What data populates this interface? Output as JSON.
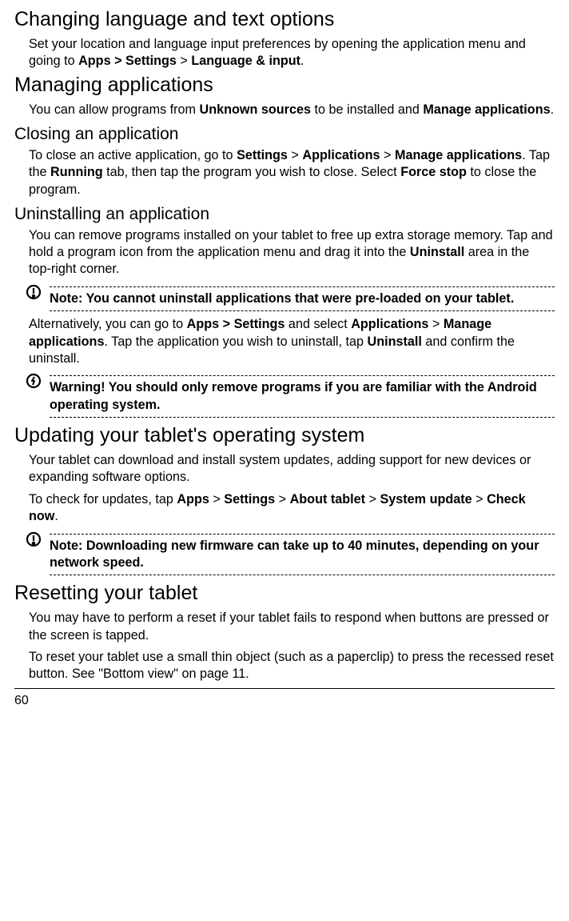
{
  "page_number": "60",
  "s1": {
    "title": "Changing language and text options",
    "p1_a": "Set your location and language input preferences by opening the application menu and going to ",
    "p1_b": "Apps > Settings",
    "p1_c": " > ",
    "p1_d": "Language & input",
    "p1_e": "."
  },
  "s2": {
    "title": "Managing applications",
    "p1_a": "You can allow programs from ",
    "p1_b": "Unknown sources",
    "p1_c": " to be installed and ",
    "p1_d": "Manage applications",
    "p1_e": "."
  },
  "s3": {
    "title": "Closing an application",
    "p1_a": "To close an active application, go to ",
    "p1_b": "Settings",
    "p1_c": " > ",
    "p1_d": "Applications",
    "p1_e": " > ",
    "p1_f": "Manage applications",
    "p1_g": ". Tap the ",
    "p1_h": "Running",
    "p1_i": " tab, then tap the program you wish to close. Select ",
    "p1_j": "Force stop",
    "p1_k": " to close the program."
  },
  "s4": {
    "title": "Uninstalling an application",
    "p1_a": "You can remove programs installed on your tablet to free up extra storage memory. Tap and hold a program icon from the application menu and drag it into the ",
    "p1_b": "Uninstall",
    "p1_c": " area in the top-right corner.",
    "note1": "Note: You cannot uninstall applications that were pre-loaded on your tablet.",
    "p2_a": "Alternatively, you can go to ",
    "p2_b": "Apps > Settings",
    "p2_c": " and select ",
    "p2_d": "Applications",
    "p2_e": " > ",
    "p2_f": "Manage applications",
    "p2_g": ". Tap the application you wish to uninstall, tap ",
    "p2_h": "Uninstall",
    "p2_i": " and confirm the uninstall.",
    "warn1": "Warning! You should only remove programs if you are familiar with the Android operating system."
  },
  "s5": {
    "title": "Updating your tablet's operating system",
    "p1": "Your tablet can download and install system updates, adding support for new devices or expanding software options.",
    "p2_a": "To check for updates, tap ",
    "p2_b": "Apps",
    "p2_c": " > ",
    "p2_d": "Settings",
    "p2_e": " > ",
    "p2_f": "About tablet",
    "p2_g": " > ",
    "p2_h": "System update",
    "p2_i": " > ",
    "p2_j": "Check now",
    "p2_k": ".",
    "note1": "Note: Downloading new firmware can take up to 40 minutes, depending on your network speed."
  },
  "s6": {
    "title": "Resetting your tablet",
    "p1": "You may have to perform a reset if your tablet fails to respond when buttons are pressed or the screen is tapped.",
    "p2": "To reset your tablet use a small thin object (such as a paperclip) to press the recessed reset button. See \"Bottom view\" on page 11."
  }
}
